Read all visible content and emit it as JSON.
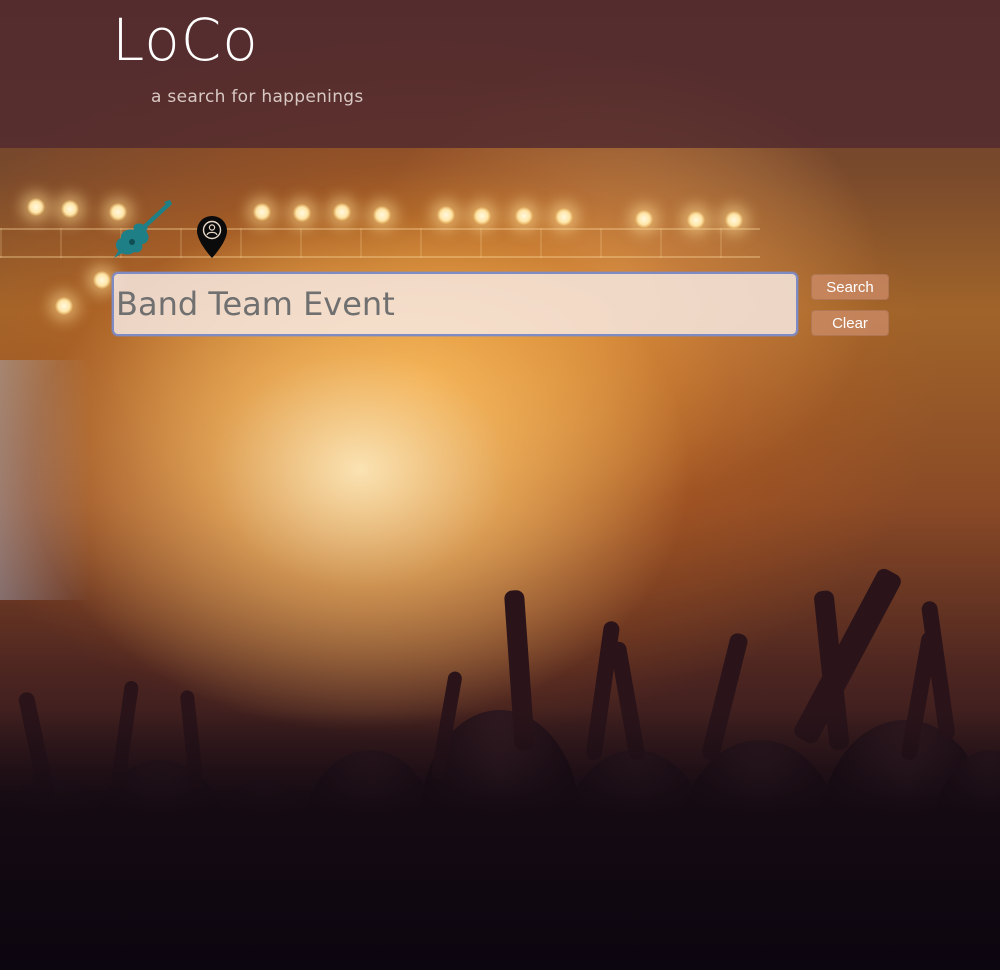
{
  "header": {
    "logo": "LoCo",
    "tagline": "a search for happenings"
  },
  "categories": [
    {
      "icon": "guitar-icon",
      "color": "#1f7f86"
    },
    {
      "icon": "map-pin-icon",
      "color": "#0b0b0b"
    }
  ],
  "search": {
    "placeholder": "Band Team Event",
    "value": "",
    "search_label": "Search",
    "clear_label": "Clear"
  },
  "colors": {
    "header_band": "#502a2e",
    "input_border": "#7f8cc4",
    "button_bg": "#cd8c69",
    "guitar": "#1f7f86"
  }
}
